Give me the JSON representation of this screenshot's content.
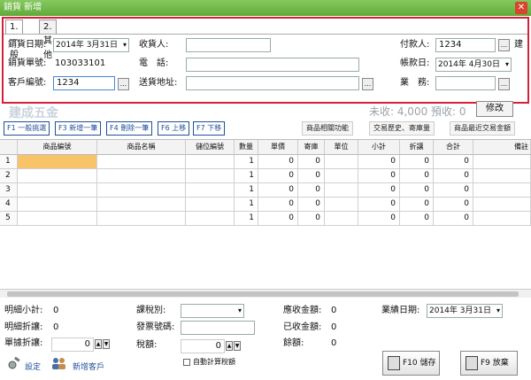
{
  "window": {
    "title": "銷貨 新增",
    "close_glyph": "✕"
  },
  "tabs": [
    "1.一般",
    "2.其他"
  ],
  "header": {
    "date_label": "銷貨日期:",
    "date_value": "2014年 3月31日",
    "receiver_label": "收貨人:",
    "receiver_value": "",
    "payer_label": "付款人:",
    "payer_value": "1234",
    "extra_label": "建",
    "no_label": "銷貨單號:",
    "no_value": "103033101",
    "phone_label": "電　話:",
    "phone_value": "",
    "account_date_label": "帳款日:",
    "account_date_value": "2014年 4月30日",
    "customer_label": "客戶編號:",
    "customer_value": "1234",
    "address_label": "送貨地址:",
    "address_value": "",
    "sales_label": "業　務:",
    "sales_value": "",
    "ellipsis": "..."
  },
  "summary": {
    "shop_name": "建成五金",
    "uncollected": "未收: 4,000",
    "prepaid": "預收: 0",
    "modify_label": "修改"
  },
  "toolbar": {
    "f1": "F1 一般挑選",
    "f3": "F3 新增一筆",
    "f4": "F4 刪除一筆",
    "f6": "F6 上移",
    "f7": "F7 下移",
    "related": "商品相關功能",
    "history": "交易歷史、寄庫量",
    "recent": "商品最近交易金額"
  },
  "grid": {
    "columns": [
      "",
      "商品編號",
      "商品名稱",
      "儲位編號",
      "數量",
      "單價",
      "寄庫",
      "單位",
      "小計",
      "折讓",
      "合計",
      "備註"
    ],
    "rows": [
      {
        "n": "1",
        "qty": "1",
        "price": "0",
        "consign": "0",
        "subtotal": "0",
        "discount": "0",
        "total": "0"
      },
      {
        "n": "2",
        "qty": "1",
        "price": "0",
        "consign": "0",
        "subtotal": "0",
        "discount": "0",
        "total": "0"
      },
      {
        "n": "3",
        "qty": "1",
        "price": "0",
        "consign": "0",
        "subtotal": "0",
        "discount": "0",
        "total": "0"
      },
      {
        "n": "4",
        "qty": "1",
        "price": "0",
        "consign": "0",
        "subtotal": "0",
        "discount": "0",
        "total": "0"
      },
      {
        "n": "5",
        "qty": "1",
        "price": "0",
        "consign": "0",
        "subtotal": "0",
        "discount": "0",
        "total": "0"
      }
    ]
  },
  "footer": {
    "detail_subtotal_label": "明細小計:",
    "detail_subtotal_value": "0",
    "detail_discount_label": "明細折讓:",
    "detail_discount_value": "0",
    "doc_discount_label": "單據折讓:",
    "doc_discount_value": "0",
    "tax_type_label": "課稅別:",
    "tax_type_value": "",
    "invoice_label": "發票號碼:",
    "invoice_value": "",
    "tax_label": "稅額:",
    "tax_value": "0",
    "receivable_label": "應收金額:",
    "receivable_value": "0",
    "received_label": "已收金額:",
    "received_value": "0",
    "balance_label": "餘額:",
    "balance_value": "0",
    "perf_date_label": "業績日期:",
    "perf_date_value": "2014年 3月31日",
    "auto_tax_label": "自動計算稅額",
    "settings_label": "設定",
    "new_customer_label": "新增客戶",
    "save_label": "F10 儲存",
    "discard_label": "F9 放棄"
  }
}
